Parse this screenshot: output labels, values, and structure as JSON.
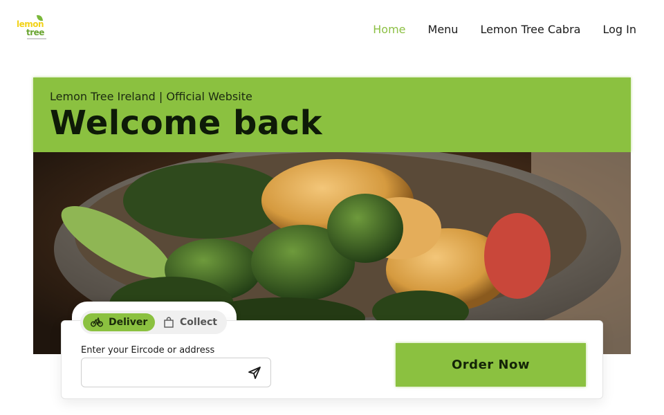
{
  "brand": {
    "logo_top": "lemon",
    "logo_bottom": "tree"
  },
  "nav": {
    "items": [
      {
        "label": "Home",
        "active": true
      },
      {
        "label": "Menu",
        "active": false
      },
      {
        "label": "Lemon Tree Cabra",
        "active": false
      },
      {
        "label": "Log In",
        "active": false
      }
    ]
  },
  "hero": {
    "subtitle": "Lemon Tree Ireland | Official Website",
    "title": "Welcome back"
  },
  "order": {
    "modes": [
      {
        "label": "Deliver",
        "icon": "bicycle-icon",
        "selected": true
      },
      {
        "label": "Collect",
        "icon": "shopping-bag-icon",
        "selected": false
      }
    ],
    "address_label": "Enter your Eircode or address",
    "address_value": "",
    "address_placeholder": "",
    "send_icon": "location-arrow-icon",
    "submit_label": "Order Now"
  },
  "colors": {
    "brand_green": "#8bc140",
    "nav_active": "#8dc045",
    "logo_yellow": "#f2d21a"
  }
}
